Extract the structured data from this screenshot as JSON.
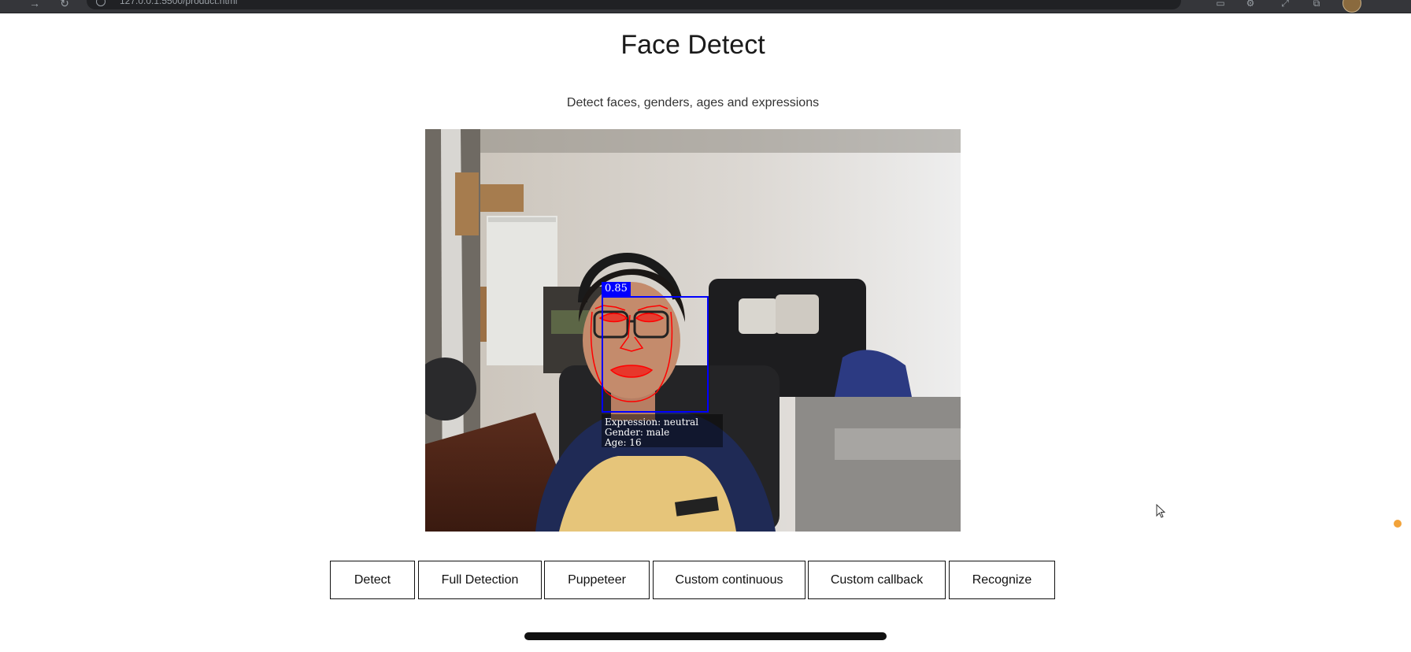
{
  "browser": {
    "url": "127.0.0.1:5500/product.html"
  },
  "page": {
    "title": "Face Detect",
    "subtitle": "Detect faces, genders, ages and expressions"
  },
  "detection": {
    "score": "0.85",
    "expression": "Expression: neutral",
    "gender": "Gender: male",
    "age": "Age: 16",
    "box_color": "#0000ff",
    "landmark_color": "#ff0000"
  },
  "buttons": [
    {
      "label": "Detect"
    },
    {
      "label": "Full Detection"
    },
    {
      "label": "Puppeteer"
    },
    {
      "label": "Custom continuous"
    },
    {
      "label": "Custom callback"
    },
    {
      "label": "Recognize"
    }
  ],
  "colors": {
    "page_background": "#ffffff",
    "button_border": "#111111",
    "recording_dot": "#f2a33a"
  }
}
